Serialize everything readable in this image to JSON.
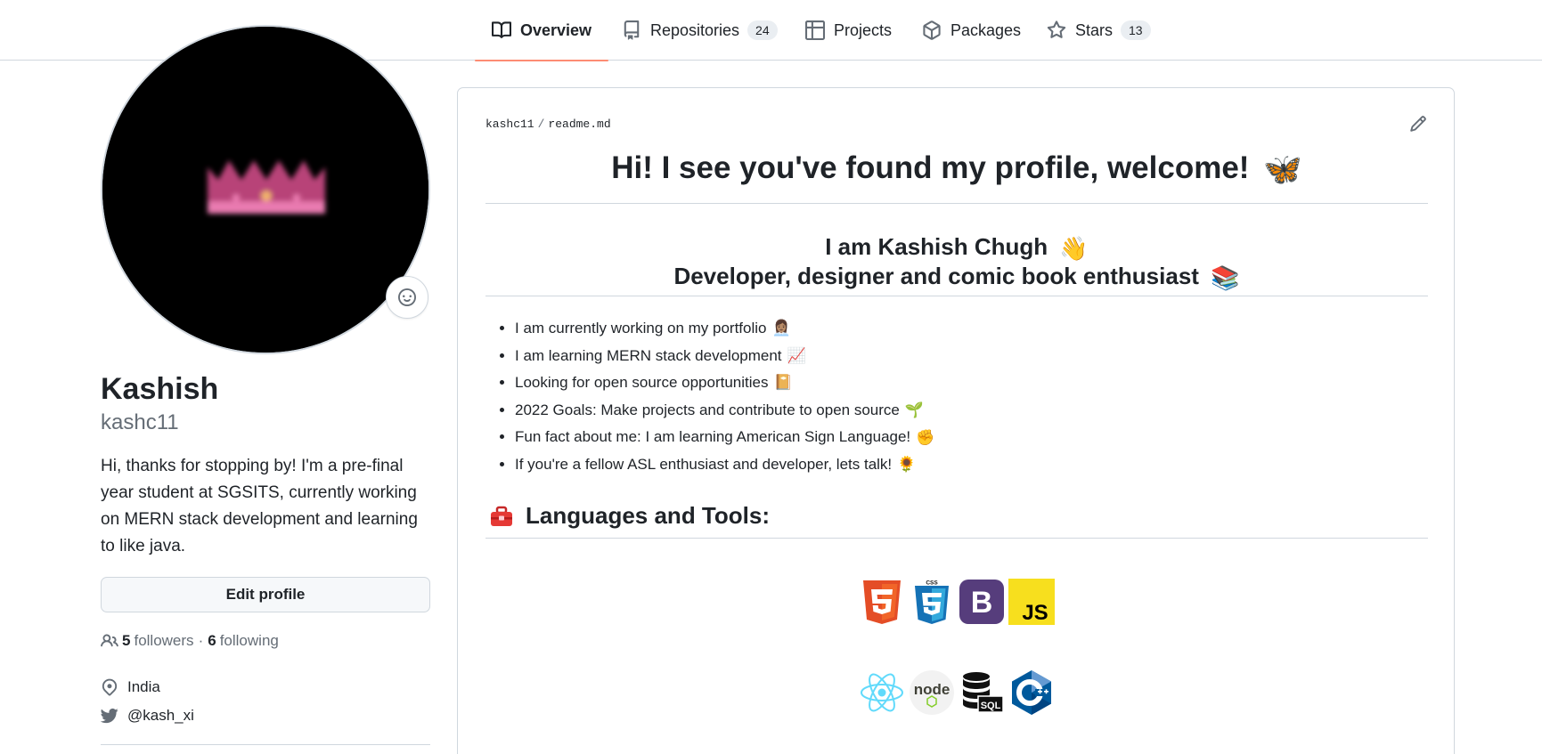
{
  "nav": {
    "tabs": [
      {
        "label": "Overview",
        "icon": "book-icon"
      },
      {
        "label": "Repositories",
        "icon": "repo-icon",
        "count": "24"
      },
      {
        "label": "Projects",
        "icon": "table-icon"
      },
      {
        "label": "Packages",
        "icon": "package-icon"
      },
      {
        "label": "Stars",
        "icon": "star-icon",
        "count": "13"
      }
    ]
  },
  "profile": {
    "name": "Kashish",
    "login": "kashc11",
    "bio": "Hi, thanks for stopping by! I'm a pre-final year student at SGSITS, currently working on MERN stack development and learning to like java.",
    "edit_label": "Edit profile",
    "followers_count": "5",
    "followers_label": "followers",
    "following_count": "6",
    "following_label": "following",
    "separator": "·",
    "location": "India",
    "twitter": "@kash_xi"
  },
  "readme": {
    "owner": "kashc11",
    "file": "readme.md",
    "path_sep": "/",
    "heading": "Hi! I see you've found my profile, welcome!",
    "heading_emoji": "🦋",
    "intro_line1": "I am Kashish Chugh",
    "intro_line1_emoji": "👋",
    "intro_line2": "Developer, designer and comic book enthusiast",
    "intro_line2_emoji": "📚",
    "bullets": [
      {
        "text": "I am currently working on my portfolio",
        "emoji": "👩🏽‍💼"
      },
      {
        "text": "I am learning MERN stack development",
        "emoji": "📈"
      },
      {
        "text": "Looking for open source opportunities",
        "emoji": "📔"
      },
      {
        "text": "2022 Goals: Make projects and contribute to open source",
        "emoji": "🌱"
      },
      {
        "text": "Fun fact about me: I am learning American Sign Language!",
        "emoji": "✊"
      },
      {
        "text": "If you're a fellow ASL enthusiast and developer, lets talk!",
        "emoji": "🌻"
      }
    ],
    "tools_heading": "Languages and Tools:",
    "tools_icon": "toolbox-icon",
    "logos_row1": [
      "html5-logo",
      "css3-logo",
      "bootstrap-logo",
      "javascript-logo"
    ],
    "logos_row2": [
      "react-logo",
      "nodejs-logo",
      "sql-database-logo",
      "cplusplus-logo"
    ],
    "logo_text": {
      "css": "CSS",
      "bootstrap": "B",
      "js": "JS",
      "node": "node",
      "sql": "SQL"
    }
  },
  "colors": {
    "active_tab_underline": "#fd8c73",
    "text": "#1f2328",
    "muted": "#656d76",
    "border": "#d0d7de",
    "avatar_bg": "#000000",
    "crown": "#e0609a"
  }
}
